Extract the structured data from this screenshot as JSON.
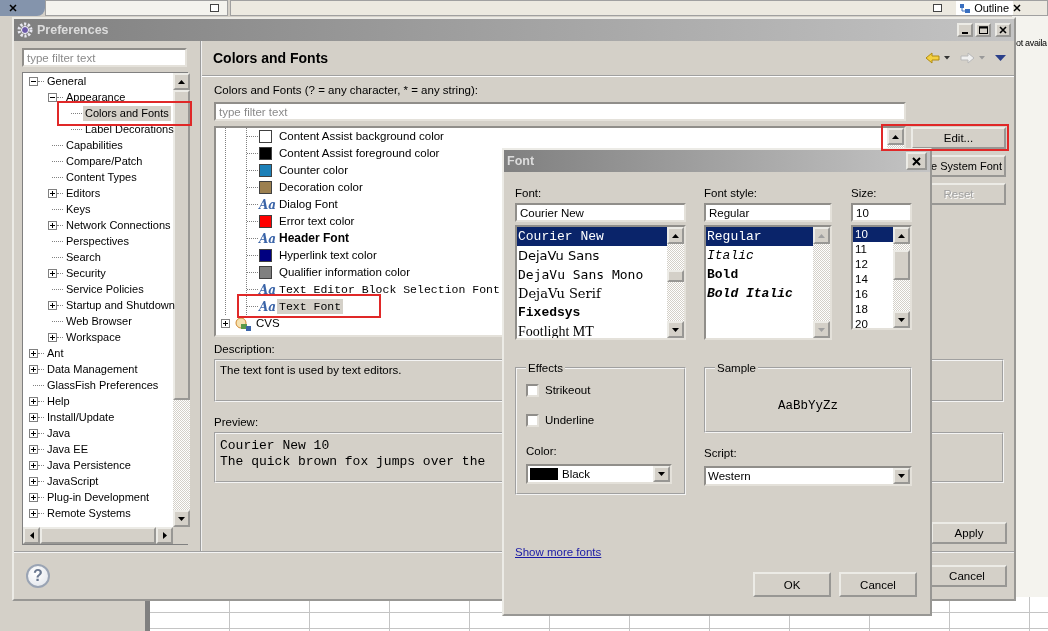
{
  "background": {
    "panel_tab": "Outline",
    "side_text": "ot availa"
  },
  "preferences": {
    "title": "Preferences",
    "filter": {
      "placeholder": "type filter text"
    },
    "tree": [
      {
        "label": "General",
        "kind": "branch",
        "expanded": true,
        "selected": false,
        "highlighted": false,
        "children": [
          {
            "label": "Appearance",
            "kind": "branch",
            "expanded": true,
            "selected": false,
            "highlighted": false,
            "children": [
              {
                "label": "Colors and Fonts",
                "kind": "leaf",
                "selected": true,
                "highlighted": true
              },
              {
                "label": "Label Decorations",
                "kind": "leaf",
                "selected": false,
                "highlighted": false
              }
            ]
          },
          {
            "label": "Capabilities",
            "kind": "leaf",
            "selected": false,
            "highlighted": false
          },
          {
            "label": "Compare/Patch",
            "kind": "leaf",
            "selected": false,
            "highlighted": false
          },
          {
            "label": "Content Types",
            "kind": "leaf",
            "selected": false,
            "highlighted": false
          },
          {
            "label": "Editors",
            "kind": "branch",
            "expanded": false,
            "selected": false,
            "highlighted": false
          },
          {
            "label": "Keys",
            "kind": "leaf",
            "selected": false,
            "highlighted": false
          },
          {
            "label": "Network Connections",
            "kind": "branch",
            "expanded": false,
            "selected": false,
            "highlighted": false
          },
          {
            "label": "Perspectives",
            "kind": "leaf",
            "selected": false,
            "highlighted": false
          },
          {
            "label": "Search",
            "kind": "leaf",
            "selected": false,
            "highlighted": false
          },
          {
            "label": "Security",
            "kind": "branch",
            "expanded": false,
            "selected": false,
            "highlighted": false
          },
          {
            "label": "Service Policies",
            "kind": "leaf",
            "selected": false,
            "highlighted": false
          },
          {
            "label": "Startup and Shutdown",
            "kind": "branch",
            "expanded": false,
            "selected": false,
            "highlighted": false
          },
          {
            "label": "Web Browser",
            "kind": "leaf",
            "selected": false,
            "highlighted": false
          },
          {
            "label": "Workspace",
            "kind": "branch",
            "expanded": false,
            "selected": false,
            "highlighted": false
          }
        ]
      },
      {
        "label": "Ant",
        "kind": "branch",
        "expanded": false,
        "selected": false,
        "highlighted": false
      },
      {
        "label": "Data Management",
        "kind": "branch",
        "expanded": false,
        "selected": false,
        "highlighted": false
      },
      {
        "label": "GlassFish Preferences",
        "kind": "leaf",
        "selected": false,
        "highlighted": false
      },
      {
        "label": "Help",
        "kind": "branch",
        "expanded": false,
        "selected": false,
        "highlighted": false
      },
      {
        "label": "Install/Update",
        "kind": "branch",
        "expanded": false,
        "selected": false,
        "highlighted": false
      },
      {
        "label": "Java",
        "kind": "branch",
        "expanded": false,
        "selected": false,
        "highlighted": false
      },
      {
        "label": "Java EE",
        "kind": "branch",
        "expanded": false,
        "selected": false,
        "highlighted": false
      },
      {
        "label": "Java Persistence",
        "kind": "branch",
        "expanded": false,
        "selected": false,
        "highlighted": false
      },
      {
        "label": "JavaScript",
        "kind": "branch",
        "expanded": false,
        "selected": false,
        "highlighted": false
      },
      {
        "label": "Plug-in Development",
        "kind": "branch",
        "expanded": false,
        "selected": false,
        "highlighted": false
      },
      {
        "label": "Remote Systems",
        "kind": "branch",
        "expanded": false,
        "selected": false,
        "highlighted": false
      }
    ],
    "page_title": "Colors and Fonts",
    "filter_label": "Colors and Fonts (? = any character, * = any string):",
    "page_filter": {
      "placeholder": "type filter text"
    },
    "items": [
      {
        "label": "Content Assist background color",
        "kind": "color",
        "color": "#ffffff",
        "selected": false,
        "highlighted": false
      },
      {
        "label": "Content Assist foreground color",
        "kind": "color",
        "color": "#000000",
        "selected": false,
        "highlighted": false
      },
      {
        "label": "Counter color",
        "kind": "color",
        "color": "#1c80b8",
        "selected": false,
        "highlighted": false
      },
      {
        "label": "Decoration color",
        "kind": "color",
        "color": "#9c8050",
        "selected": false,
        "highlighted": false
      },
      {
        "label": "Dialog Font",
        "kind": "font",
        "icon_text": "Aa",
        "selected": false,
        "highlighted": false
      },
      {
        "label": "Error text color",
        "kind": "color",
        "color": "#ff0000",
        "selected": false,
        "highlighted": false
      },
      {
        "label": "Header Font",
        "kind": "bold_font",
        "icon_text": "Aa",
        "selected": false,
        "highlighted": false
      },
      {
        "label": "Hyperlink text color",
        "kind": "color",
        "color": "#000080",
        "selected": false,
        "highlighted": false
      },
      {
        "label": "Qualifier information color",
        "kind": "color",
        "color": "#808080",
        "selected": false,
        "highlighted": false
      },
      {
        "label": "Text Editor Block Selection Font",
        "kind": "fixed_font",
        "icon_text": "Aa",
        "selected": false,
        "highlighted": false
      },
      {
        "label": "Text Font",
        "kind": "fixed_font",
        "icon_text": "Aa",
        "selected": true,
        "highlighted": true
      }
    ],
    "following_items": [
      {
        "label": "CVS",
        "expanded": false,
        "selected": false,
        "highlighted": false
      }
    ],
    "side_buttons": [
      {
        "label": "Edit...",
        "disabled": false,
        "highlighted": true
      },
      {
        "label": "e System Font",
        "disabled": false,
        "highlighted": false
      },
      {
        "label": "Reset",
        "disabled": true,
        "highlighted": false
      }
    ],
    "description_label": "Description:",
    "description": "The text font is used by text editors.",
    "preview_label": "Preview:",
    "preview_lines": [
      "Courier New 10",
      "The quick brown fox jumps over the"
    ],
    "apply_button": "Apply",
    "help_button": "?",
    "cancel_button": "Cancel"
  },
  "font_dialog": {
    "title": "Font",
    "font_label": "Font:",
    "font_value": "Courier New",
    "fonts": [
      {
        "label": "Courier New",
        "kind": "mono",
        "selected": true
      },
      {
        "label": "DejaVu Sans",
        "kind": "sans",
        "selected": false
      },
      {
        "label": "DejaVu Sans Mono",
        "kind": "sans_mono",
        "selected": false
      },
      {
        "label": "DejaVu Serif",
        "kind": "serif",
        "selected": false
      },
      {
        "label": "Fixedsys",
        "kind": "bold_mono",
        "selected": false
      },
      {
        "label": "Footlight MT",
        "kind": "old_serif",
        "selected": false
      }
    ],
    "style_label": "Font style:",
    "style_value": "Regular",
    "styles": [
      {
        "label": "Regular",
        "kind": "regular",
        "selected": true
      },
      {
        "label": "Italic",
        "kind": "italic",
        "selected": false
      },
      {
        "label": "Bold",
        "kind": "bold",
        "selected": false
      },
      {
        "label": "Bold Italic",
        "kind": "bold_italic",
        "selected": false
      }
    ],
    "size_label": "Size:",
    "size_value": "10",
    "sizes": [
      {
        "label": "10",
        "selected": true
      },
      {
        "label": "11",
        "selected": false
      },
      {
        "label": "12",
        "selected": false
      },
      {
        "label": "14",
        "selected": false
      },
      {
        "label": "16",
        "selected": false
      },
      {
        "label": "18",
        "selected": false
      },
      {
        "label": "20",
        "selected": false
      }
    ],
    "effects_label": "Effects",
    "effects": [
      {
        "label": "Strikeout",
        "checked": false
      },
      {
        "label": "Underline",
        "checked": false
      }
    ],
    "color_label": "Color:",
    "color": {
      "label": "Black",
      "color": "#000000"
    },
    "sample_label": "Sample",
    "sample": "AaBbYyZz",
    "script_label": "Script:",
    "script": "Western",
    "more_link": "Show more fonts",
    "buttons": [
      "OK",
      "Cancel"
    ]
  }
}
